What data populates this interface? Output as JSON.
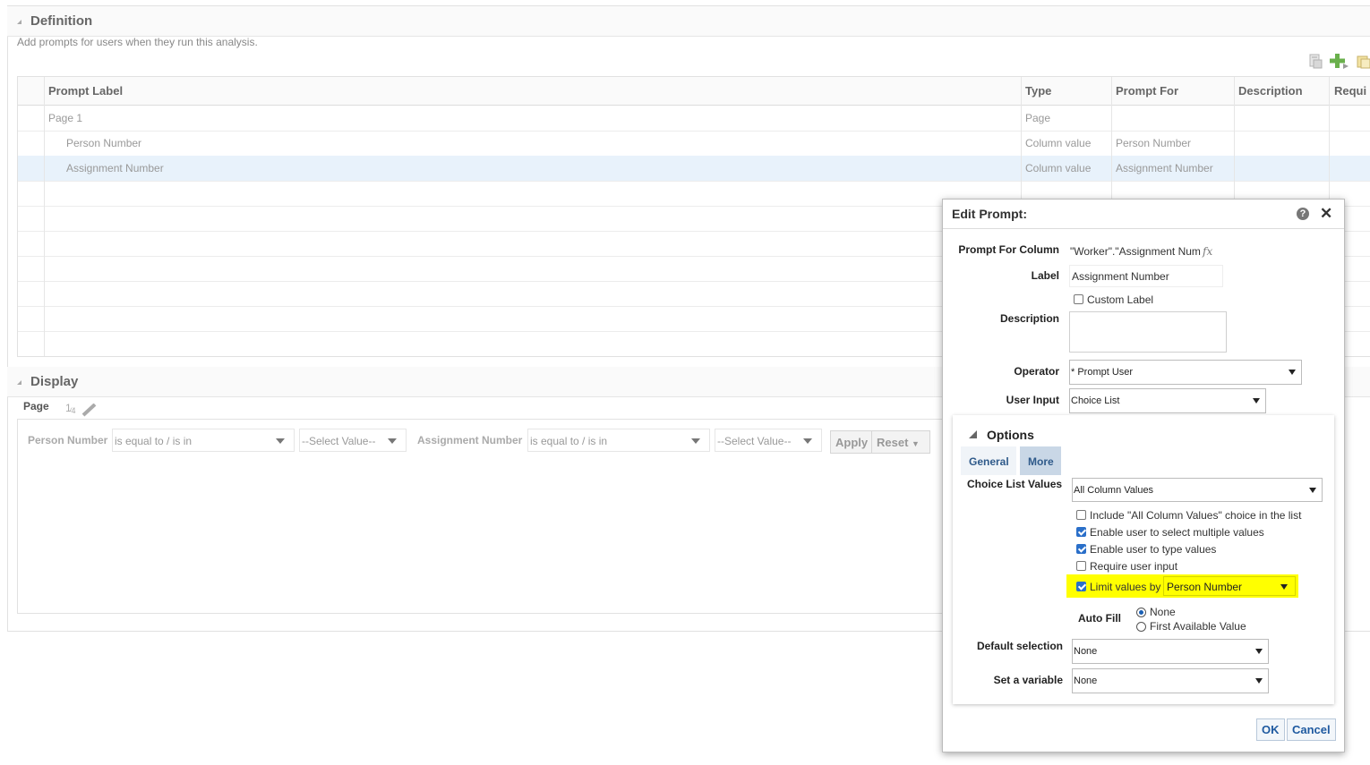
{
  "definition": {
    "title": "Definition",
    "subtitle": "Add prompts for users when they run this analysis.",
    "icons": [
      "properties-icon",
      "add-icon",
      "copy-icon"
    ],
    "columns": [
      "Prompt Label",
      "Type",
      "Prompt For",
      "Description",
      "Requi"
    ],
    "rows": [
      {
        "label": "Page 1",
        "type": "Page",
        "prompt_for": ""
      },
      {
        "label": "Person Number",
        "type": "Column value",
        "prompt_for": "Person Number"
      },
      {
        "label": "Assignment Number",
        "type": "Column value",
        "prompt_for": "Assignment Number"
      }
    ]
  },
  "display": {
    "title": "Display",
    "page_label": "Page",
    "page_value": "1",
    "prompts": [
      {
        "label": "Person Number",
        "operator": "is equal to / is in",
        "value": "--Select Value--"
      },
      {
        "label": "Assignment Number",
        "operator": "is equal to / is in",
        "value": "--Select Value--"
      }
    ],
    "apply_label": "Apply",
    "reset_label": "Reset"
  },
  "dialog": {
    "title": "Edit Prompt:",
    "help": "?",
    "close": "✕",
    "prompt_for_column_label": "Prompt For Column",
    "prompt_for_column_value": "\"Worker\".\"Assignment Num",
    "fx": "fx",
    "label_label": "Label",
    "label_value": "Assignment Number",
    "custom_label": "Custom Label",
    "description_label": "Description",
    "operator_label": "Operator",
    "operator_value": "* Prompt User",
    "user_input_label": "User Input",
    "user_input_value": "Choice List",
    "options_title": "Options",
    "tabs": [
      "General",
      "More"
    ],
    "choice_list_values_label": "Choice List Values",
    "choice_list_values_value": "All Column Values",
    "checkboxes": [
      {
        "label": "Include \"All Column Values\" choice in the list",
        "checked": false
      },
      {
        "label": "Enable user to select multiple values",
        "checked": true
      },
      {
        "label": "Enable user to type values",
        "checked": true
      },
      {
        "label": "Require user input",
        "checked": false
      }
    ],
    "limit_values_label": "Limit values by",
    "limit_values_value": "Person Number",
    "limit_values_checked": true,
    "highlight_color": "#ffff00",
    "auto_fill_label": "Auto Fill",
    "auto_fill_options": [
      "None",
      "First Available Value"
    ],
    "default_selection_label": "Default selection",
    "default_selection_value": "None",
    "set_variable_label": "Set a variable",
    "set_variable_value": "None",
    "ok_label": "OK",
    "cancel_label": "Cancel"
  }
}
